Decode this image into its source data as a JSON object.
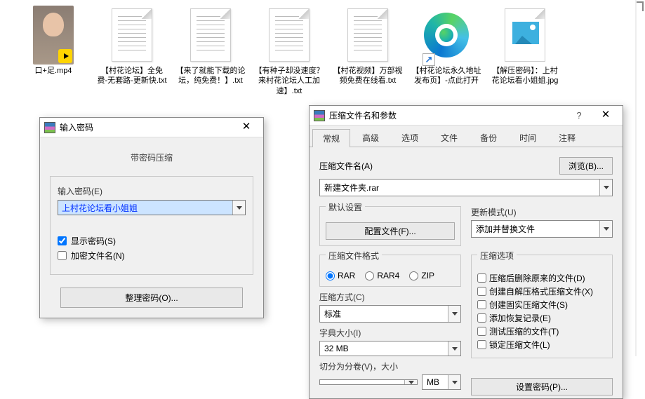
{
  "files": [
    {
      "type": "video",
      "label": "口+足.mp4"
    },
    {
      "type": "txt",
      "label": "【村花论坛】全免费-无套路-更新快.txt"
    },
    {
      "type": "txt",
      "label": "【来了就能下载的论坛，纯免费！】.txt"
    },
    {
      "type": "txt",
      "label": "【有种子却没速度？来村花论坛人工加速】.txt"
    },
    {
      "type": "txt",
      "label": "【村花视频】万部视频免费在线看.txt"
    },
    {
      "type": "edge",
      "label": "【村花论坛永久地址发布页】-点此打开"
    },
    {
      "type": "jpg",
      "label": "【解压密码】：上村花论坛看小姐姐.jpg"
    }
  ],
  "pw_dialog": {
    "title": "输入密码",
    "subtitle": "带密码压缩",
    "enter_pw_label": "输入密码(E)",
    "password_value": "上村花论坛看小姐姐",
    "show_pw": "显示密码(S)",
    "encrypt_names": "加密文件名(N)",
    "organize_btn": "整理密码(O)..."
  },
  "ar_dialog": {
    "title": "压缩文件名和参数",
    "tabs": [
      "常规",
      "高级",
      "选项",
      "文件",
      "备份",
      "时间",
      "注释"
    ],
    "archive_name_label": "压缩文件名(A)",
    "browse_btn": "浏览(B)...",
    "archive_name_value": "新建文件夹.rar",
    "default_profile": "默认设置",
    "config_btn": "配置文件(F)...",
    "update_mode_label": "更新模式(U)",
    "update_mode_value": "添加并替换文件",
    "format_label": "压缩文件格式",
    "formats": [
      "RAR",
      "RAR4",
      "ZIP"
    ],
    "options_label": "压缩选项",
    "opts": [
      "压缩后删除原来的文件(D)",
      "创建自解压格式压缩文件(X)",
      "创建固实压缩文件(S)",
      "添加恢复记录(E)",
      "测试压缩的文件(T)",
      "锁定压缩文件(L)"
    ],
    "method_label": "压缩方式(C)",
    "method_value": "标准",
    "dict_label": "字典大小(I)",
    "dict_value": "32 MB",
    "split_label": "切分为分卷(V)，大小",
    "split_unit": "MB",
    "set_pw_btn": "设置密码(P)..."
  }
}
